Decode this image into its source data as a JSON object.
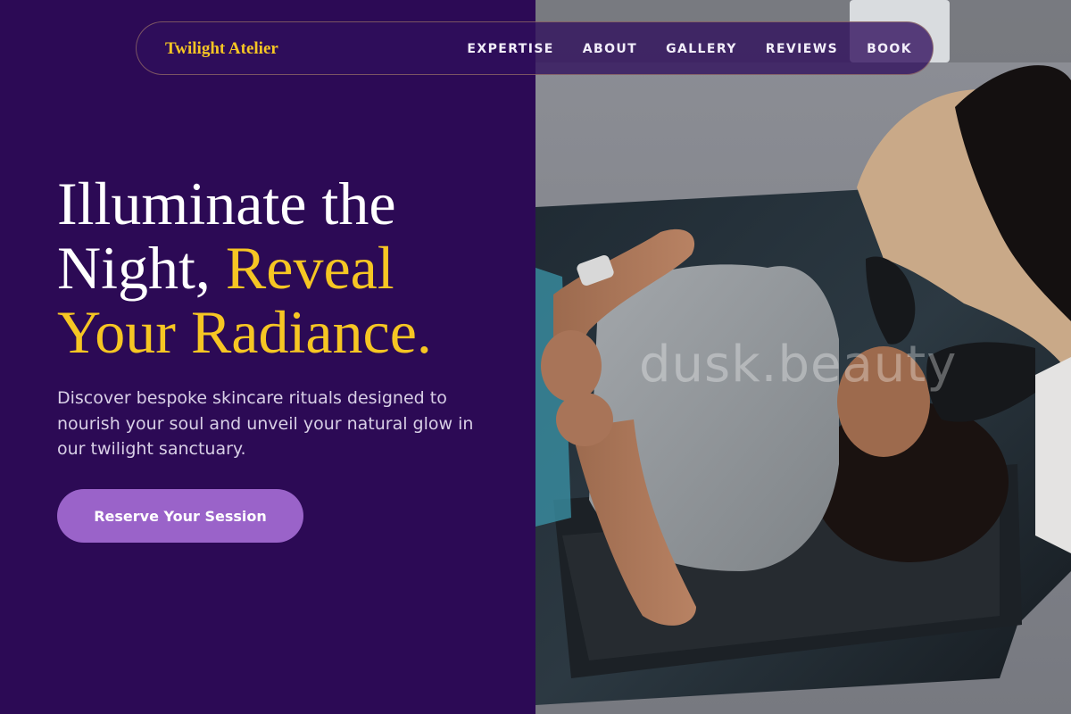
{
  "brand": {
    "name": "Twilight Atelier"
  },
  "nav": {
    "items": [
      {
        "label": "EXPERTISE"
      },
      {
        "label": "ABOUT"
      },
      {
        "label": "GALLERY"
      },
      {
        "label": "REVIEWS"
      },
      {
        "label": "BOOK"
      }
    ]
  },
  "hero": {
    "headline_part1": "Illuminate the Night, ",
    "headline_accent": "Reveal Your Radiance.",
    "subtext": "Discover bespoke skincare rituals designed to nourish your soul and unveil your natural glow in our twilight sanctuary.",
    "cta_label": "Reserve Your Session",
    "watermark": "dusk.beauty"
  },
  "colors": {
    "background": "#2c0a55",
    "accent_gold": "#f6c623",
    "button_purple": "#9a63c9",
    "nav_text": "#f2eefa"
  }
}
